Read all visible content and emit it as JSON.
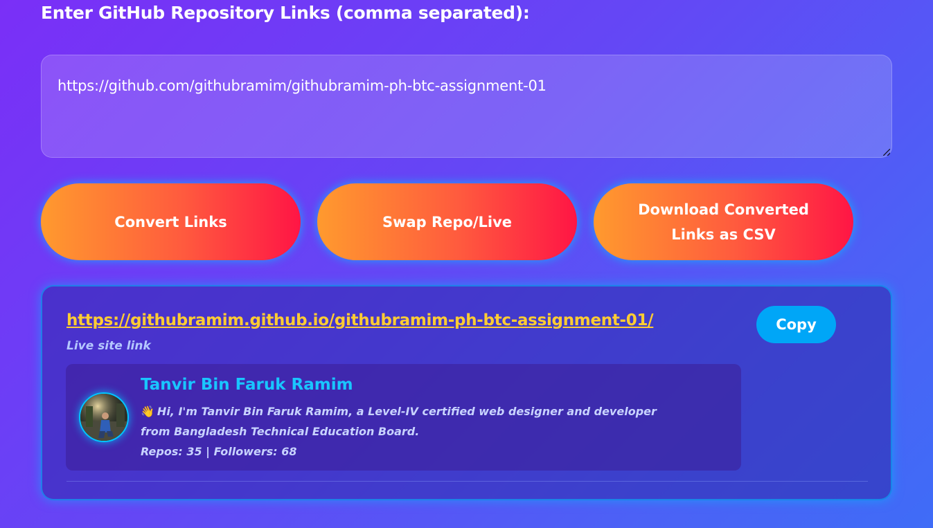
{
  "form": {
    "heading": "Enter GitHub Repository Links (comma separated):",
    "textarea_value": "https://github.com/githubramim/githubramim-ph-btc-assignment-01"
  },
  "buttons": {
    "convert_label": "Convert Links",
    "swap_label": "Swap Repo/Live",
    "download_label": "Download Converted Links as CSV"
  },
  "result": {
    "live_url": "https://githubramim.github.io/githubramim-ph-btc-assignment-01/",
    "caption": "Live site link",
    "copy_label": "Copy",
    "profile": {
      "name": "Tanvir Bin Faruk Ramim",
      "bio": "Hi, I'm Tanvir Bin Faruk Ramim, a Level-IV certified web designer and developer from Bangladesh Technical Education Board.",
      "stats": "Repos: 35 | Followers: 68",
      "wave_icon": "waving-hand-icon"
    }
  },
  "colors": {
    "button_gradient_start": "#ff9a2e",
    "button_gradient_end": "#ff1545",
    "link_color": "#ffcc33",
    "name_color": "#19c6ff",
    "copy_button": "#00a6f7"
  }
}
